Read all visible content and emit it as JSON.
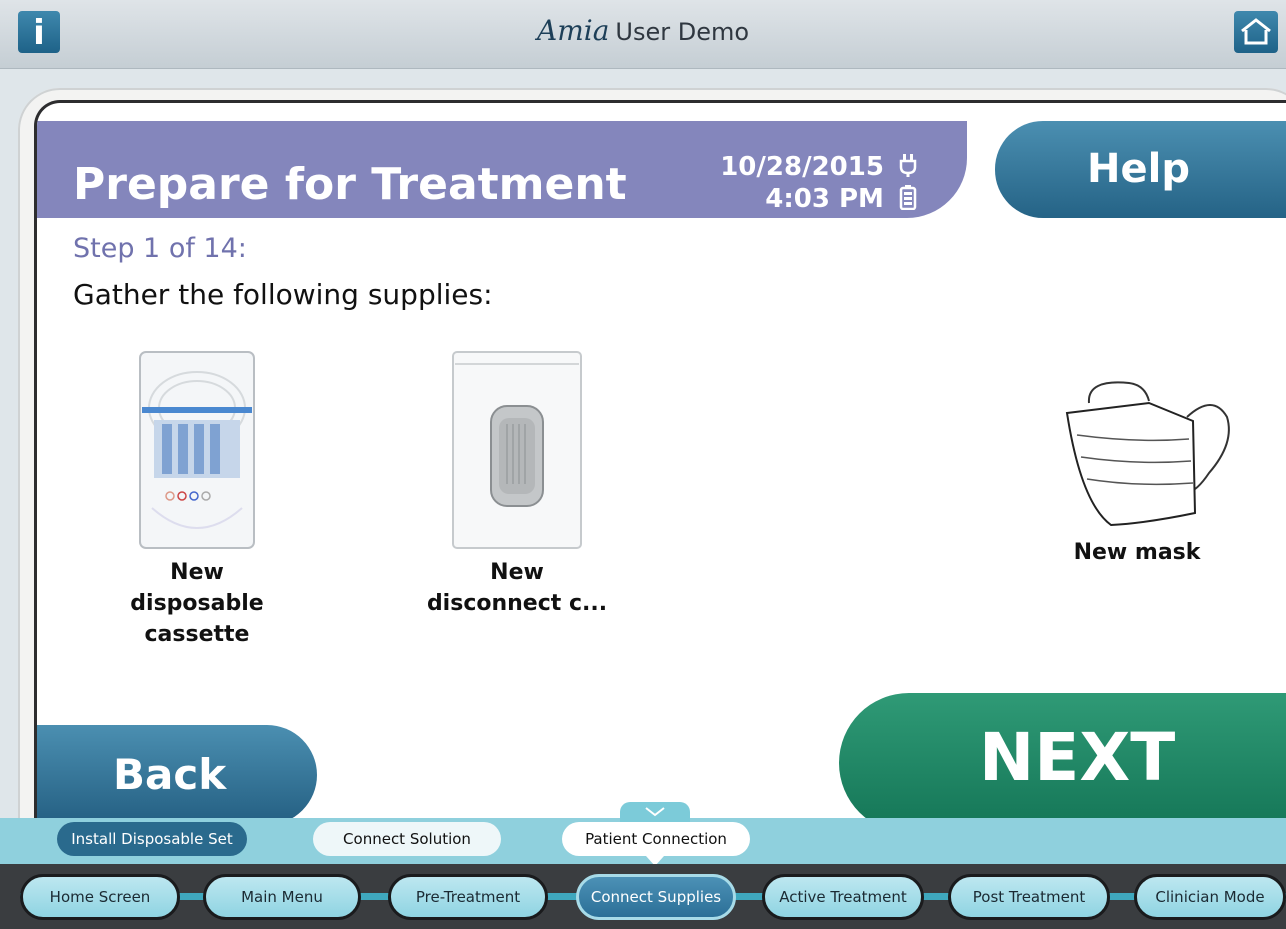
{
  "topbar": {
    "info_icon": "info-icon",
    "home_icon": "home-icon",
    "logo_text": "Amia",
    "app_title": "User Demo"
  },
  "header": {
    "title": "Prepare for Treatment",
    "date": "10/28/2015",
    "time": "4:03 PM",
    "power_icon": "plug-icon",
    "battery_icon": "battery-icon",
    "help_label": "Help"
  },
  "content": {
    "step_label": "Step 1 of 14:",
    "instruction": "Gather the following supplies:",
    "supplies": [
      {
        "lines": [
          "New",
          "disposable",
          "cassette"
        ],
        "icon": "cassette-image"
      },
      {
        "lines": [
          "New",
          "disconnect c..."
        ],
        "icon": "disconnect-cap-image"
      },
      {
        "lines": [
          "New mask"
        ],
        "icon": "mask-image"
      }
    ]
  },
  "buttons": {
    "back_label": "Back",
    "next_label": "NEXT"
  },
  "substeps": [
    {
      "label": "Install Disposable Set",
      "state": "done"
    },
    {
      "label": "Connect Solution",
      "state": "pending"
    },
    {
      "label": "Patient Connection",
      "state": "current"
    }
  ],
  "mainnav": [
    {
      "label": "Home Screen"
    },
    {
      "label": "Main Menu"
    },
    {
      "label": "Pre-Treatment"
    },
    {
      "label": "Connect Supplies",
      "active": true
    },
    {
      "label": "Active Treatment"
    },
    {
      "label": "Post Treatment"
    },
    {
      "label": "Clinician Mode"
    }
  ],
  "colors": {
    "header_purple": "#8486bc",
    "help_blue": "#256386",
    "next_green": "#147556",
    "nav_cyan": "#8fd4e2"
  }
}
